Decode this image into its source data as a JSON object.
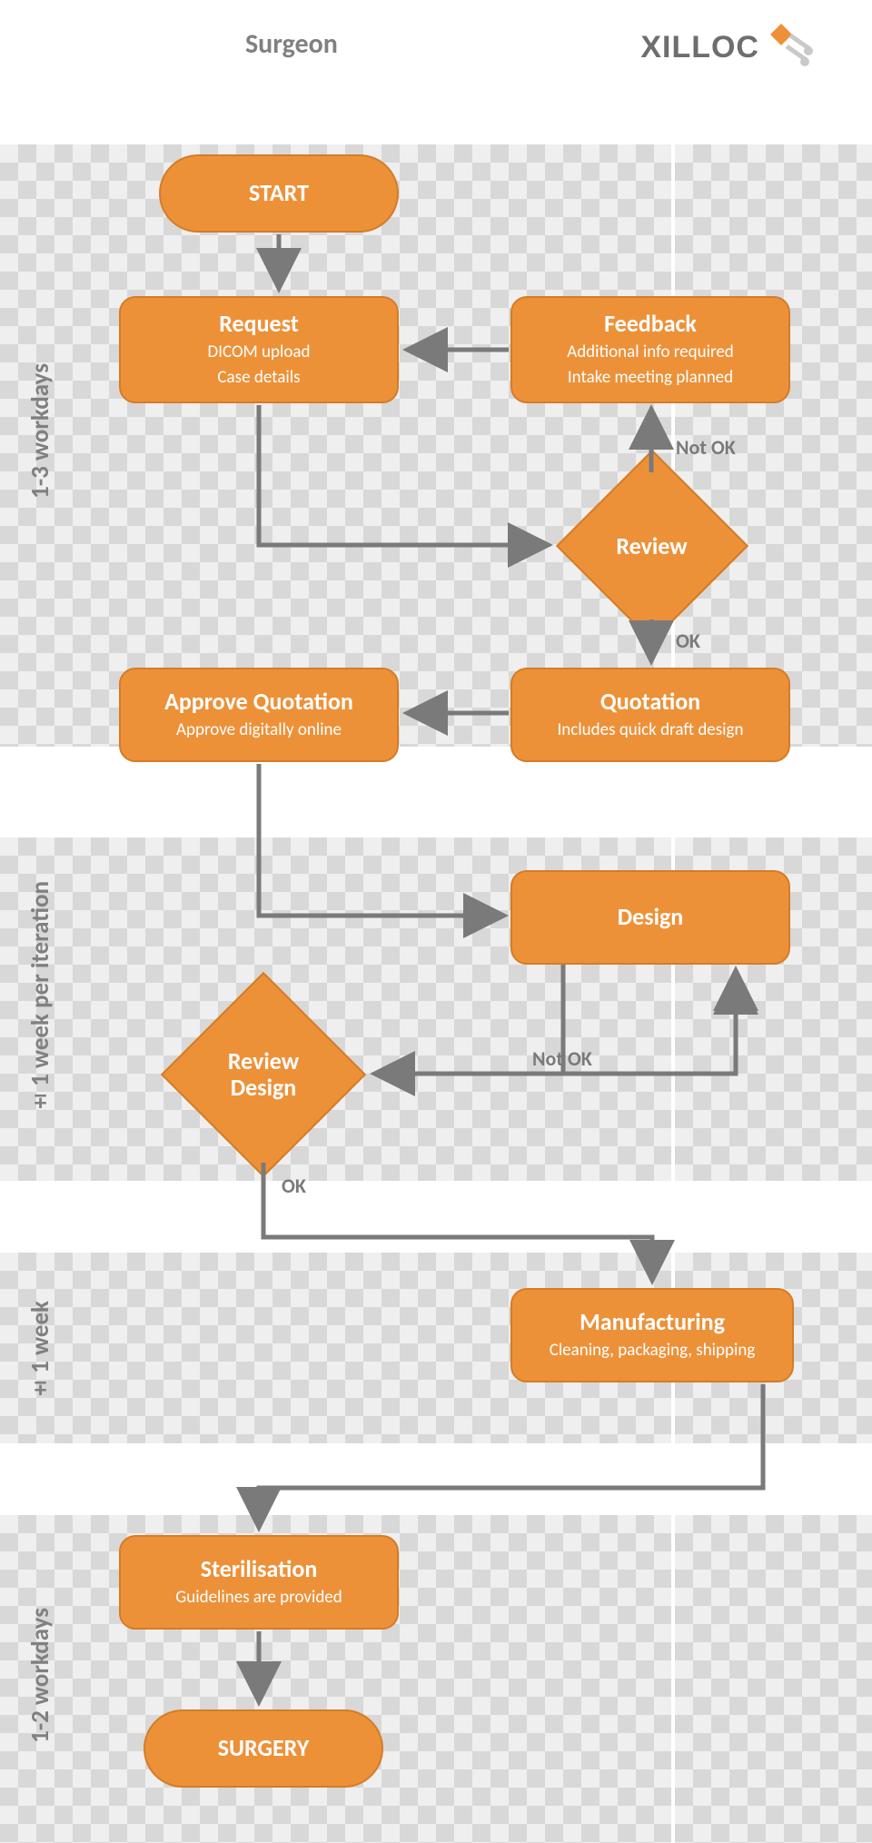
{
  "columns": {
    "surgeon": "Surgeon",
    "xilloc": "XILLOC"
  },
  "phases": {
    "p1": "1-3 workdays",
    "p2": "±1 week per iteration",
    "p3": "±1 week",
    "p4": "1-2 workdays"
  },
  "nodes": {
    "start": {
      "title": "START"
    },
    "request": {
      "title": "Request",
      "sub1": "DICOM upload",
      "sub2": "Case details"
    },
    "feedback": {
      "title": "Feedback",
      "sub1": "Additional info required",
      "sub2": "Intake meeting planned"
    },
    "review": {
      "title": "Review"
    },
    "quotation": {
      "title": "Quotation",
      "sub1": "Includes quick draft design"
    },
    "approve": {
      "title": "Approve Quotation",
      "sub1": "Approve digitally online"
    },
    "design": {
      "title": "Design"
    },
    "reviewDesign": {
      "title1": "Review",
      "title2": "Design"
    },
    "manufacturing": {
      "title": "Manufacturing",
      "sub1": "Cleaning, packaging, shipping"
    },
    "sterilisation": {
      "title": "Sterilisation",
      "sub1": "Guidelines are provided"
    },
    "surgery": {
      "title": "SURGERY"
    }
  },
  "edges": {
    "notOk1": "Not OK",
    "ok1": "OK",
    "notOk2": "Not OK",
    "ok2": "OK"
  },
  "colors": {
    "node": "#ed9139",
    "arrow": "#7a7a7a"
  }
}
